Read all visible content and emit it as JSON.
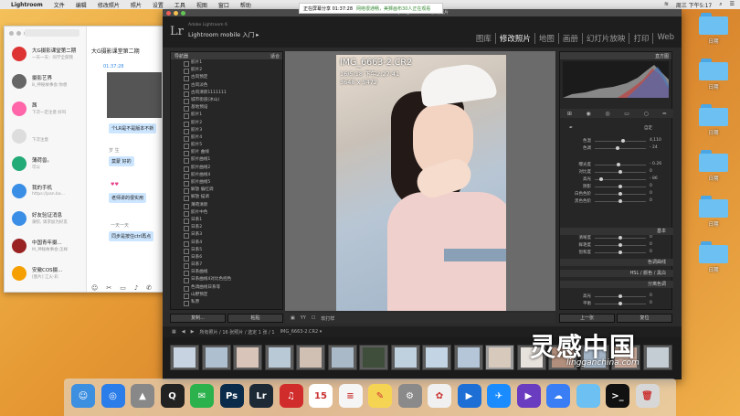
{
  "menubar": {
    "app": "Lightroom",
    "items": [
      "文件",
      "编辑",
      "修改照片",
      "照片",
      "设置",
      "工具",
      "视图",
      "窗口",
      "帮助"
    ],
    "clock": "周三 下午5:17"
  },
  "sharebar": {
    "text": "正在屏幕分享 01:37:28",
    "status": "网络很通畅，美狮画布30人正在观看"
  },
  "chat": {
    "title": "大G摄影课堂第二期",
    "conversations": [
      {
        "name": "大G摄影课堂第二期",
        "preview": "一天一天：同学全部我",
        "color": "#d33"
      },
      {
        "name": "摄影艺界",
        "preview": "B_神秘故事会:你想",
        "color": "#666"
      },
      {
        "name": "茜",
        "preview": "下次一定注意 好吗",
        "color": "#f6a"
      },
      {
        "name": "",
        "preview": "下次注意",
        "color": "#ddd"
      },
      {
        "name": "薄荷兽。",
        "preview": "可以",
        "color": "#2a7"
      },
      {
        "name": "我的手机",
        "preview": "https://pan.ba...",
        "color": "#3a8ee6"
      },
      {
        "name": "好友验证消息",
        "preview": "蒲钦, 请求加为好友",
        "color": "#3a8ee6"
      },
      {
        "name": "中国青年摄...",
        "preview": "M_神秘故事会:怎样",
        "color": "#922"
      },
      {
        "name": "安徽COS摄...",
        "preview": "[图片] 江火·彩",
        "color": "#f5a000"
      }
    ],
    "time": "01:37:28",
    "messages": [
      "个LR是不是版本不新",
      "莫蒙 好的",
      "老师讲的很实用",
      "同步是按住ctrl再点"
    ],
    "senders": [
      "岁 生",
      "一天一天"
    ]
  },
  "lightroom": {
    "window_title": "ap Lightroom - 修改照片",
    "brand_small": "Adobe Lightroom 6",
    "brand_big": "Lightroom mobile 入门 ▸",
    "modules": [
      "图库",
      "修改照片",
      "地图",
      "画册",
      "幻灯片放映",
      "打印",
      "Web"
    ],
    "active_module": "修改照片",
    "navigator_label": "导航器",
    "navigator_fit": "适合",
    "presets": [
      "胶片1",
      "胶片2",
      "古风预定",
      "古风淡色",
      "古风清新1111111",
      "城市街道(冰山)",
      "基地预设",
      "胶片1",
      "胶片2",
      "胶片3",
      "胶片4",
      "胶片5",
      "胶片 曲线",
      "胶片曲线1",
      "胶片曲线2",
      "胶片曲线4",
      "胶片曲线5",
      "解放 偏红调",
      "解放 描调",
      "薄荷清新",
      "胶片中色",
      "日系1",
      "日系2",
      "日系3",
      "日系4",
      "日系5",
      "日系6",
      "日系7",
      "日系曲线",
      "日系曲线4对比色控色",
      "色调曲线日系等",
      "山野预定",
      "私原"
    ],
    "left_buttons": [
      "复制...",
      "粘贴"
    ],
    "photo": {
      "filename": "IMG_6663-2.CR2",
      "date": "16/5/18 下午2:27:41",
      "dimensions": "3648 x 5472"
    },
    "toolbar_label": "软打样",
    "right": {
      "histogram_label": "直方图",
      "sliders": [
        {
          "label": "色温",
          "value": "4,110",
          "pos": 0.55
        },
        {
          "label": "色调",
          "value": "- 24",
          "pos": 0.45
        },
        {
          "label": "曝光度",
          "value": "- 0.26",
          "pos": 0.46
        },
        {
          "label": "对比度",
          "value": "0",
          "pos": 0.5
        },
        {
          "label": "高光",
          "value": "- 86",
          "pos": 0.12
        },
        {
          "label": "阴影",
          "value": "0",
          "pos": 0.5
        },
        {
          "label": "白色色阶",
          "value": "0",
          "pos": 0.5
        },
        {
          "label": "黑色色阶",
          "value": "0",
          "pos": 0.5
        },
        {
          "label": "清晰度",
          "value": "0",
          "pos": 0.5
        },
        {
          "label": "鲜艳度",
          "value": "0",
          "pos": 0.5
        },
        {
          "label": "饱和度",
          "value": "0",
          "pos": 0.5
        }
      ],
      "sections": [
        "色调曲线",
        "HSL / 颜色 / 黑白",
        "分离色调"
      ],
      "basic_label": "基本",
      "wb_label": "自定",
      "split": [
        {
          "label": "高光",
          "value": "0",
          "pos": 0.5
        },
        {
          "label": "平衡",
          "value": "0",
          "pos": 0.5
        }
      ],
      "buttons": [
        "上一张",
        "复位"
      ]
    },
    "filmstrip": {
      "label": "所有照片 / 16 张照片 / 选定 1 张 / 1",
      "filename": "IMG_6663-2.CR2 ▾"
    }
  },
  "desktop": {
    "folders": [
      "日期",
      "日期",
      "日期",
      "日期",
      "日期",
      "日期"
    ],
    "watermark_cn": "灵感中国",
    "watermark_url": "lingganchina.com"
  },
  "dock": {
    "apps": [
      {
        "name": "Finder",
        "glyph": "☺",
        "color": "#3d8fe0"
      },
      {
        "name": "Safari",
        "glyph": "◎",
        "color": "#2b7de9"
      },
      {
        "name": "Launchpad",
        "glyph": "▲",
        "color": "#888"
      },
      {
        "name": "QQ",
        "glyph": "Q",
        "color": "#222"
      },
      {
        "name": "WeChat",
        "glyph": "✉",
        "color": "#2bb24c"
      },
      {
        "name": "Photoshop",
        "glyph": "Ps",
        "color": "#0a2b4a"
      },
      {
        "name": "Lightroom",
        "glyph": "Lr",
        "color": "#1d2a36"
      },
      {
        "name": "NetEase Music",
        "glyph": "♫",
        "color": "#d12c2c"
      },
      {
        "name": "Calendar",
        "glyph": "15",
        "color": "#ffffff"
      },
      {
        "name": "Reminders",
        "glyph": "≡",
        "color": "#f5f5f5"
      },
      {
        "name": "Notes",
        "glyph": "✎",
        "color": "#f6d453"
      },
      {
        "name": "System Preferences",
        "glyph": "⚙",
        "color": "#8a8a8a"
      },
      {
        "name": "Photos",
        "glyph": "✿",
        "color": "#f0f0f0"
      },
      {
        "name": "Video",
        "glyph": "▶",
        "color": "#1d6fd6"
      },
      {
        "name": "Feishu",
        "glyph": "✈",
        "color": "#1a8cff"
      },
      {
        "name": "Player",
        "glyph": "▶",
        "color": "#6a3cc0"
      },
      {
        "name": "Baidu Pan",
        "glyph": "☁",
        "color": "#3a7ef5"
      },
      {
        "name": "Folder",
        "glyph": "",
        "color": "#6cc0f2"
      },
      {
        "name": "Terminal",
        "glyph": ">_",
        "color": "#111"
      },
      {
        "name": "Trash",
        "glyph": "🗑",
        "color": "#d7d7d7"
      }
    ]
  }
}
